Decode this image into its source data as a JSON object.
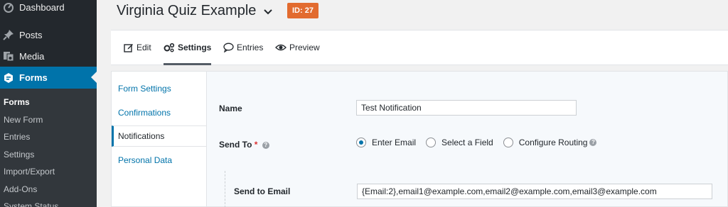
{
  "sidebar": {
    "menu": [
      {
        "label": "Dashboard",
        "icon": "dashboard-icon"
      },
      {
        "label": "Posts",
        "icon": "pin-icon"
      },
      {
        "label": "Media",
        "icon": "media-icon"
      },
      {
        "label": "Forms",
        "icon": "forms-icon"
      }
    ],
    "submenu": [
      "Forms",
      "New Form",
      "Entries",
      "Settings",
      "Import/Export",
      "Add-Ons",
      "System Status"
    ]
  },
  "header": {
    "title": "Virginia Quiz Example",
    "id_badge": "ID: 27",
    "badge_color": "#e26b2f"
  },
  "toolbar": {
    "items": [
      {
        "label": "Edit",
        "icon": "edit-icon"
      },
      {
        "label": "Settings",
        "icon": "gears-icon"
      },
      {
        "label": "Entries",
        "icon": "comment-icon"
      },
      {
        "label": "Preview",
        "icon": "eye-icon"
      }
    ],
    "active": "Settings"
  },
  "settings_nav": {
    "items": [
      "Form Settings",
      "Confirmations",
      "Notifications",
      "Personal Data"
    ],
    "active": "Notifications"
  },
  "form": {
    "name_label": "Name",
    "name_value": "Test Notification",
    "send_to_label": "Send To",
    "required_mark": "*",
    "send_to_options": [
      "Enter Email",
      "Select a Field",
      "Configure Routing"
    ],
    "send_to_selected": "Enter Email",
    "send_to_email_label": "Send to Email",
    "send_to_email_value": "{Email:2},email1@example.com,email2@example.com,email3@example.com"
  },
  "colors": {
    "accent": "#0073aa",
    "sidebar_bg": "#23282d",
    "required": "#dc3232"
  }
}
